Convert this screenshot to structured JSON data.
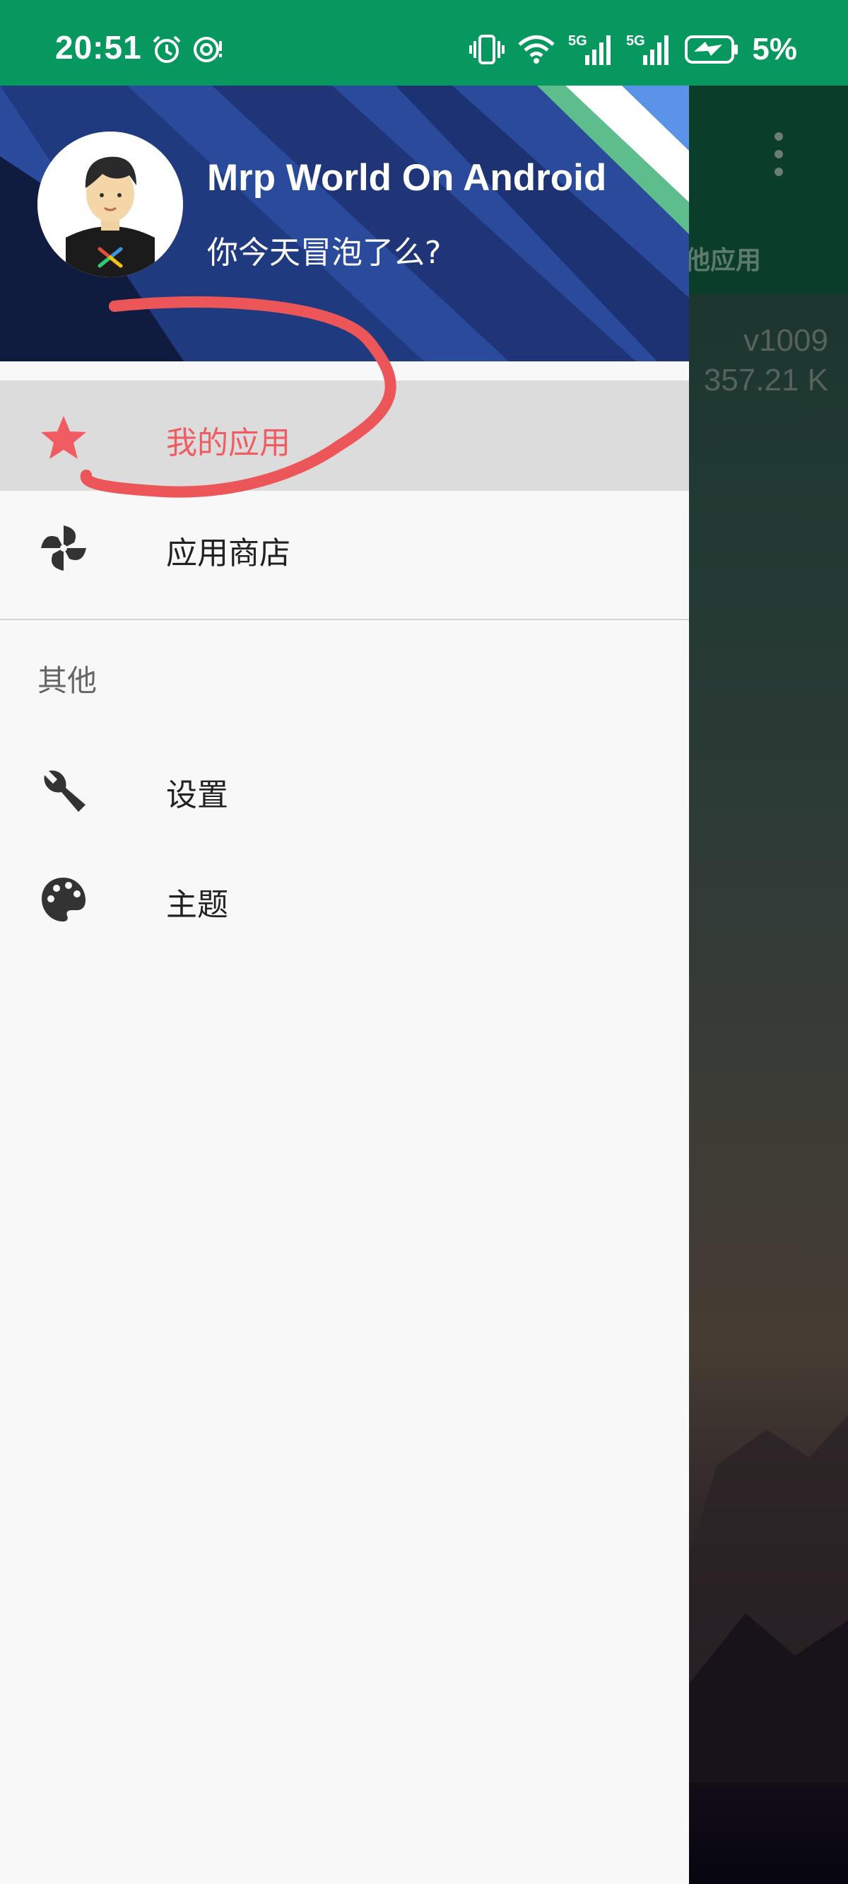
{
  "status_bar": {
    "time": "20:51",
    "battery_percent": "5%",
    "network_1": "5G",
    "network_2": "5G",
    "icons": [
      "alarm-icon",
      "eye-comfort-icon",
      "vibrate-icon",
      "wifi-icon",
      "signal-icon",
      "signal-icon",
      "battery-charging-icon"
    ]
  },
  "drawer": {
    "header": {
      "title": "Mrp World On Android",
      "subtitle": "你今天冒泡了么?"
    },
    "items": [
      {
        "label": "我的应用",
        "icon": "star-icon",
        "selected": true
      },
      {
        "label": "应用商店",
        "icon": "pinwheel-icon",
        "selected": false
      }
    ],
    "section_title": "其他",
    "other_items": [
      {
        "label": "设置",
        "icon": "wrench-icon"
      },
      {
        "label": "主题",
        "icon": "palette-icon"
      }
    ]
  },
  "background": {
    "tab_label": "他应用",
    "version": "v1009",
    "size": "357.21 K"
  },
  "colors": {
    "status_bar": "#06985f",
    "header_blue": "#2a4a9c",
    "accent_red": "#f05c62",
    "selected_bg": "#dcdcdc"
  }
}
